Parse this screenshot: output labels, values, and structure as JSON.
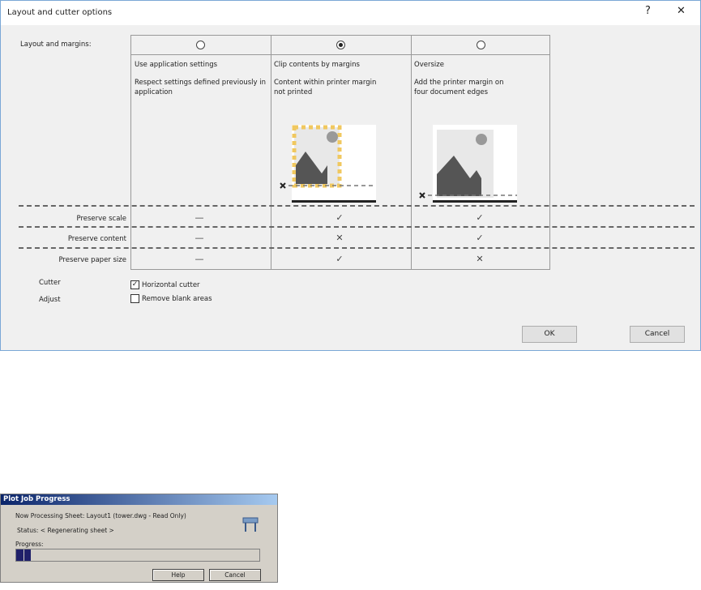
{
  "dialog": {
    "title": "Layout and cutter options",
    "help": "?",
    "close": "✕",
    "layout_label": "Layout and margins:",
    "options": [
      {
        "title": "Use application settings",
        "desc": "Respect settings defined previously in application",
        "selected": false
      },
      {
        "title": "Clip contents by margins",
        "desc": "Content within printer margin not printed",
        "selected": true
      },
      {
        "title": "Oversize",
        "desc": "Add the printer margin on four document edges",
        "selected": false
      }
    ],
    "rows": [
      {
        "label": "Preserve scale",
        "values": [
          "—",
          "✓",
          "✓"
        ]
      },
      {
        "label": "Preserve content",
        "values": [
          "—",
          "✕",
          "✓"
        ]
      },
      {
        "label": "Preserve paper size",
        "values": [
          "—",
          "✓",
          "✕"
        ]
      }
    ],
    "cutter_label": "Cutter",
    "horizontal_cutter": "Horizontal cutter",
    "horizontal_cutter_checked": true,
    "adjust_label": "Adjust",
    "remove_blank": "Remove blank areas",
    "remove_blank_checked": false,
    "ok": "OK",
    "cancel": "Cancel"
  },
  "progress": {
    "title": "Plot Job Progress",
    "sheet": "Now Processing Sheet: Layout1 (tower.dwg - Read Only)",
    "status": "Status: < Regenerating sheet >",
    "progress_label": "Progress:",
    "progress_percent": 6,
    "help": "Help",
    "cancel": "Cancel"
  }
}
